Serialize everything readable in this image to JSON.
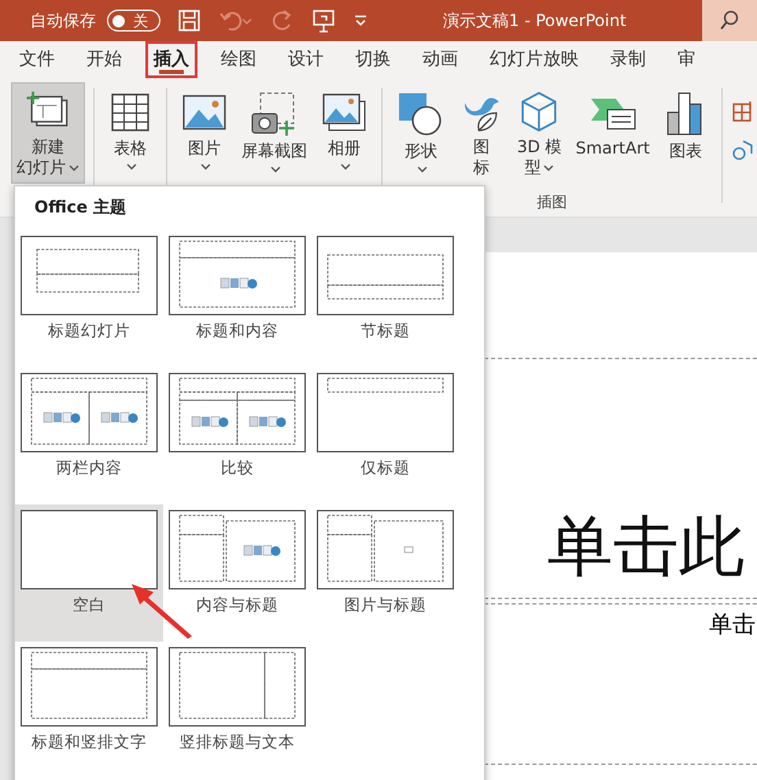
{
  "title_bar": {
    "autosave_label": "自动保存",
    "autosave_toggle": {
      "label": "关",
      "on": false
    },
    "title": "演示文稿1  -  PowerPoint"
  },
  "tabs": [
    {
      "label": "文件",
      "selected": false,
      "annotated": false
    },
    {
      "label": "开始",
      "selected": false,
      "annotated": false
    },
    {
      "label": "插入",
      "selected": true,
      "annotated": true
    },
    {
      "label": "绘图",
      "selected": false,
      "annotated": false
    },
    {
      "label": "设计",
      "selected": false,
      "annotated": false
    },
    {
      "label": "切换",
      "selected": false,
      "annotated": false
    },
    {
      "label": "动画",
      "selected": false,
      "annotated": false
    },
    {
      "label": "幻灯片放映",
      "selected": false,
      "annotated": false
    },
    {
      "label": "录制",
      "selected": false,
      "annotated": false
    },
    {
      "label": "审",
      "selected": false,
      "annotated": false
    }
  ],
  "ribbon": {
    "groups": [
      {
        "buttons": [
          {
            "kind": "new-slide",
            "lines": [
              "新建",
              "幻灯片"
            ],
            "has_menu": true,
            "pressed": true
          }
        ]
      },
      {
        "buttons": [
          {
            "kind": "table",
            "lines": [
              "表格"
            ],
            "has_menu": true,
            "pressed": false
          }
        ]
      },
      {
        "buttons": [
          {
            "kind": "picture",
            "lines": [
              "图片"
            ],
            "has_menu": true,
            "pressed": false
          },
          {
            "kind": "screenshot",
            "lines": [
              "屏幕截图"
            ],
            "has_menu": true,
            "pressed": false
          },
          {
            "kind": "album",
            "lines": [
              "相册"
            ],
            "has_menu": true,
            "pressed": false
          }
        ]
      },
      {
        "label": "插图",
        "buttons": [
          {
            "kind": "shapes",
            "lines": [
              "形状"
            ],
            "has_menu": true,
            "pressed": false
          },
          {
            "kind": "icons",
            "lines": [
              "图",
              "标"
            ],
            "has_menu": false,
            "pressed": false
          },
          {
            "kind": "cube",
            "lines": [
              "3D 模",
              "型"
            ],
            "has_menu": true,
            "pressed": false
          },
          {
            "kind": "smartart",
            "lines": [
              "SmartArt"
            ],
            "has_menu": false,
            "pressed": false
          },
          {
            "kind": "chart",
            "lines": [
              "图表"
            ],
            "has_menu": false,
            "pressed": false
          }
        ]
      }
    ]
  },
  "layout_gallery": {
    "heading": "Office 主题",
    "layouts": [
      {
        "name": "标题幻灯片",
        "kind": "title",
        "selected": false
      },
      {
        "name": "标题和内容",
        "kind": "title-content",
        "selected": false
      },
      {
        "name": "节标题",
        "kind": "section",
        "selected": false
      },
      {
        "name": "两栏内容",
        "kind": "two-content",
        "selected": false
      },
      {
        "name": "比较",
        "kind": "comparison",
        "selected": false
      },
      {
        "name": "仅标题",
        "kind": "title-only",
        "selected": false
      },
      {
        "name": "空白",
        "kind": "blank",
        "selected": true
      },
      {
        "name": "内容与标题",
        "kind": "content-caption",
        "selected": false
      },
      {
        "name": "图片与标题",
        "kind": "picture-caption",
        "selected": false
      },
      {
        "name": "标题和竖排文字",
        "kind": "title-vertical",
        "selected": false
      },
      {
        "name": "竖排标题与文本",
        "kind": "vertical-title",
        "selected": false
      }
    ]
  },
  "pointer_arrow": true,
  "slide": {
    "title_placeholder": "单击此",
    "subtitle_placeholder": "单击"
  }
}
